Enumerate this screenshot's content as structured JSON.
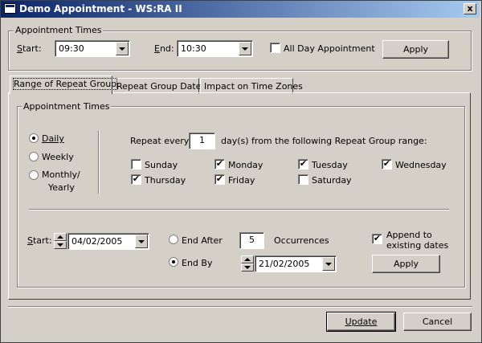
{
  "window": {
    "title": "Demo Appointment - WS:RA II",
    "close_glyph": "x"
  },
  "appt_times": {
    "legend": "Appointment Times",
    "start_label": "Start:",
    "start_value": "09:30",
    "end_label": "End:",
    "end_value": "10:30",
    "all_day_label": "All Day Appointment",
    "all_day_checked": false,
    "apply_label": "Apply"
  },
  "tabs": [
    {
      "label": "Range of Repeat Group",
      "active": true
    },
    {
      "label": "Repeat Group Dates",
      "active": false
    },
    {
      "label": "Impact on Time Zones",
      "active": false
    }
  ],
  "repeat": {
    "legend": "Appointment Times",
    "freq": [
      {
        "label": "Daily",
        "selected": true
      },
      {
        "label": "Weekly",
        "selected": false
      },
      {
        "label": "Monthly/",
        "label2": "Yearly",
        "selected": false
      }
    ],
    "repeat_every_label": "Repeat every",
    "repeat_every_value": "1",
    "repeat_suffix": "day(s) from the following Repeat Group range:",
    "days": [
      {
        "label": "Sunday",
        "checked": false
      },
      {
        "label": "Monday",
        "checked": true
      },
      {
        "label": "Tuesday",
        "checked": true
      },
      {
        "label": "Wednesday",
        "checked": true
      },
      {
        "label": "Thursday",
        "checked": true
      },
      {
        "label": "Friday",
        "checked": true
      },
      {
        "label": "Saturday",
        "checked": false
      }
    ],
    "range_start_label": "Start:",
    "range_start_value": "04/02/2005",
    "end_after_label": "End After",
    "end_after_selected": false,
    "occurrences_value": "5",
    "occurrences_label": "Occurrences",
    "end_by_label": "End By",
    "end_by_selected": true,
    "end_by_value": "21/02/2005",
    "append_label_1": "Append to",
    "append_label_2": "existing dates",
    "append_checked": true,
    "apply_label": "Apply"
  },
  "footer": {
    "update_label": "Update",
    "cancel_label": "Cancel"
  },
  "check_glyph": "✔"
}
